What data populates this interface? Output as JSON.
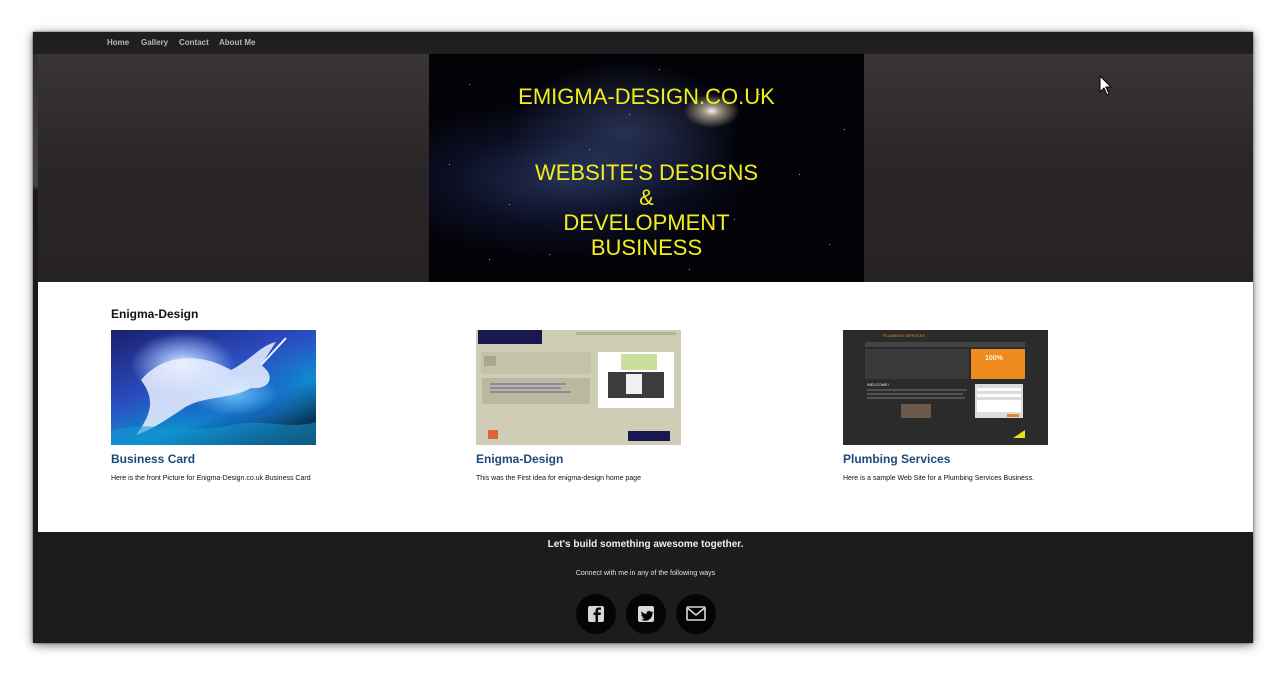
{
  "nav": {
    "items": [
      {
        "label": "Home"
      },
      {
        "label": "Gallery"
      },
      {
        "label": "Contact"
      },
      {
        "label": "About Me"
      }
    ]
  },
  "banner": {
    "title": "EMIGMA-DESIGN.CO.UK",
    "subtitle_lines": [
      "WEBSITE'S DESIGNS",
      "&",
      "DEVELOPMENT",
      "BUSINESS"
    ]
  },
  "content": {
    "section_title": "Enigma-Design",
    "cards": [
      {
        "title": "Business Card",
        "description": "Here is the front Picture for Enigma-Design.co.uk Business Card"
      },
      {
        "title": "Enigma-Design",
        "description": "This was the First idea for enigma-design home page"
      },
      {
        "title": "Plumbing Services",
        "description": "Here is a sample Web Site for a Plumbing Services Business."
      }
    ]
  },
  "thumbs": {
    "plumbing": {
      "header": "PLUMBING SERVICES",
      "welcome": "WELCOME!",
      "badge": "100%"
    }
  },
  "footer": {
    "heading": "Let's build something awesome together.",
    "subtext": "Connect with me in any of the following ways",
    "social": [
      {
        "icon": "facebook-icon"
      },
      {
        "icon": "twitter-icon"
      },
      {
        "icon": "mail-icon"
      }
    ]
  },
  "colors": {
    "banner_text": "#f2ee1e",
    "card_title": "#1c4a7d",
    "footer_bg": "#1c1c1c"
  }
}
